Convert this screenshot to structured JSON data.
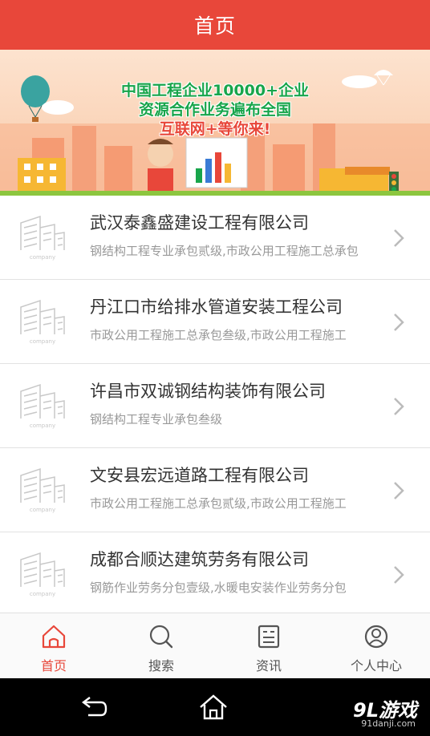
{
  "header": {
    "title": "首页"
  },
  "banner": {
    "line1": "中国工程企业10000+企业",
    "line2": "资源合作业务遍布全国",
    "line3": "互联网+等你来!"
  },
  "companies": [
    {
      "name": "武汉泰鑫盛建设工程有限公司",
      "desc": "钢结构工程专业承包贰级,市政公用工程施工总承包"
    },
    {
      "name": "丹江口市给排水管道安装工程公司",
      "desc": "市政公用工程施工总承包叁级,市政公用工程施工"
    },
    {
      "name": "许昌市双诚钢结构装饰有限公司",
      "desc": "钢结构工程专业承包叁级"
    },
    {
      "name": "文安县宏远道路工程有限公司",
      "desc": "市政公用工程施工总承包贰级,市政公用工程施工"
    },
    {
      "name": "成都合顺达建筑劳务有限公司",
      "desc": "钢筋作业劳务分包壹级,水暖电安装作业劳务分包"
    }
  ],
  "logo_text": "company",
  "tabs": [
    {
      "label": "首页",
      "icon": "home-icon",
      "active": true
    },
    {
      "label": "搜索",
      "icon": "search-icon",
      "active": false
    },
    {
      "label": "资讯",
      "icon": "news-icon",
      "active": false
    },
    {
      "label": "个人中心",
      "icon": "user-icon",
      "active": false
    }
  ],
  "watermark": {
    "brand": "9L游戏",
    "url": "91danji.com"
  },
  "colors": {
    "accent": "#e8473a",
    "banner_green": "#18a54b"
  }
}
